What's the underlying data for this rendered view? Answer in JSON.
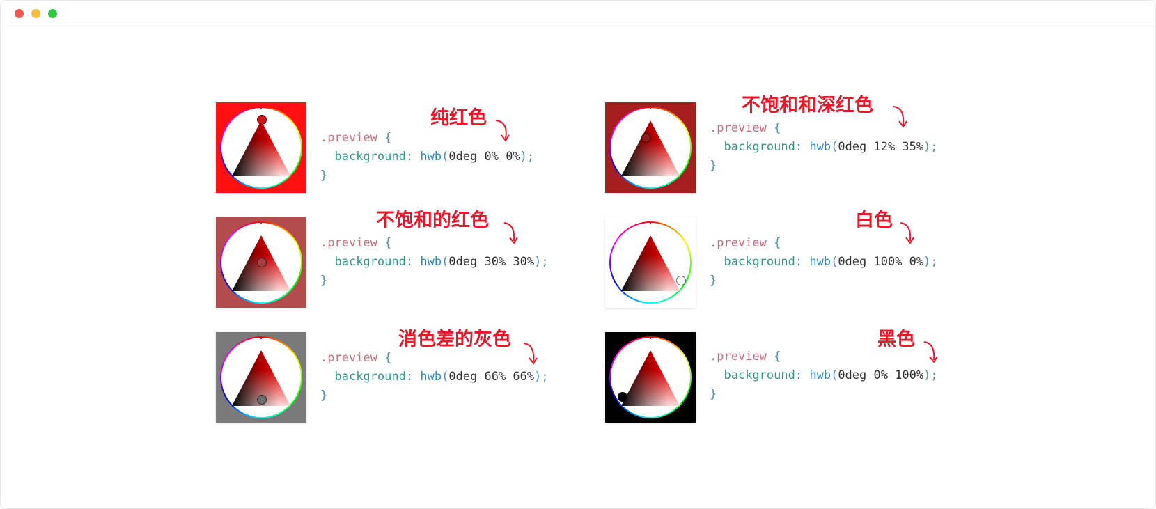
{
  "window": {
    "controls": [
      {
        "name": "close",
        "color": "#ee5a52"
      },
      {
        "name": "minimize",
        "color": "#f5be3b"
      },
      {
        "name": "zoom",
        "color": "#2cc840"
      }
    ]
  },
  "colors": {
    "annotation": "#e8182a",
    "selector": "#c96d7b",
    "property": "#2f9a8c",
    "function": "#2f8ac8"
  },
  "examples": [
    {
      "annotation": "纯红色",
      "selector": ".preview",
      "open_brace": "{",
      "property": "background",
      "colon": ":",
      "function": "hwb",
      "args": "0deg 0% 0%",
      "close_brace": "}",
      "swatch_color": "#ff1010"
    },
    {
      "annotation": "不饱和和深红色",
      "selector": ".preview",
      "open_brace": "{",
      "property": "background",
      "colon": ":",
      "function": "hwb",
      "args": "0deg 12% 35%",
      "close_brace": "}",
      "swatch_color": "#a51f1f"
    },
    {
      "annotation": "不饱和的红色",
      "selector": ".preview",
      "open_brace": "{",
      "property": "background",
      "colon": ":",
      "function": "hwb",
      "args": "0deg 30% 30%",
      "close_brace": "}",
      "swatch_color": "#b34d4d"
    },
    {
      "annotation": "白色",
      "selector": ".preview",
      "open_brace": "{",
      "property": "background",
      "colon": ":",
      "function": "hwb",
      "args": "0deg 100% 0%",
      "close_brace": "}",
      "swatch_color": "#ffffff"
    },
    {
      "annotation": "消色差的灰色",
      "selector": ".preview",
      "open_brace": "{",
      "property": "background",
      "colon": ":",
      "function": "hwb",
      "args": "0deg 66% 66%",
      "close_brace": "}",
      "swatch_color": "#7a7a7a"
    },
    {
      "annotation": "黑色",
      "selector": ".preview",
      "open_brace": "{",
      "property": "background",
      "colon": ":",
      "function": "hwb",
      "args": "0deg 0% 100%",
      "close_brace": "}",
      "swatch_color": "#000000"
    }
  ]
}
